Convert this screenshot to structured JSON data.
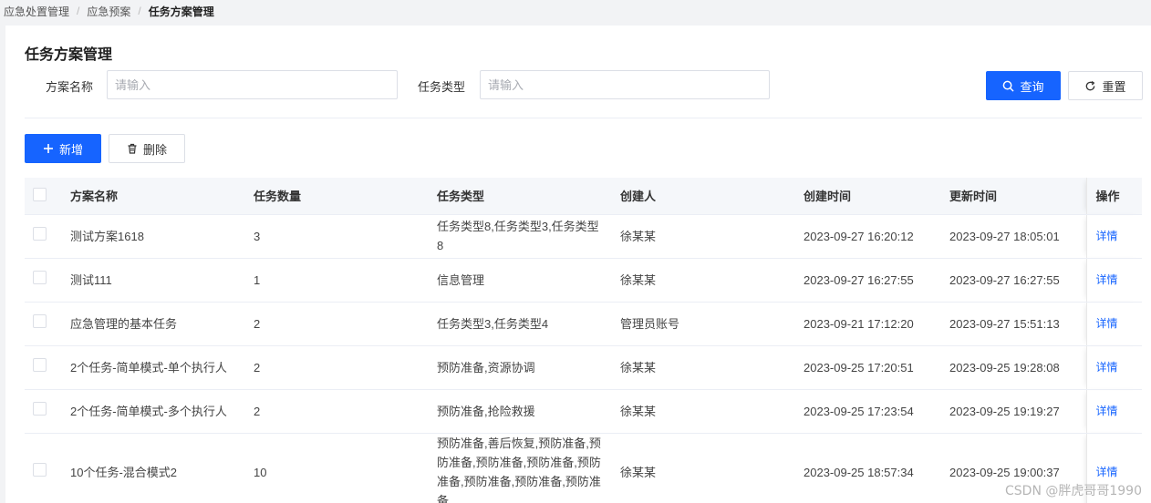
{
  "breadcrumb": [
    "应急处置管理",
    "应急预案",
    "任务方案管理"
  ],
  "page_title": "任务方案管理",
  "filters": {
    "name_label": "方案名称",
    "name_placeholder": "请输入",
    "type_label": "任务类型",
    "type_placeholder": "请输入"
  },
  "buttons": {
    "query": "查询",
    "reset": "重置",
    "add": "新增",
    "delete": "删除"
  },
  "table": {
    "columns": [
      "方案名称",
      "任务数量",
      "任务类型",
      "创建人",
      "创建时间",
      "更新时间",
      "操作"
    ],
    "rows": [
      {
        "name": "测试方案1618",
        "count": "3",
        "types": "任务类型8,任务类型3,任务类型8",
        "creator": "徐某某",
        "created": "2023-09-27 16:20:12",
        "updated": "2023-09-27 18:05:01",
        "action": "详情"
      },
      {
        "name": "测试111",
        "count": "1",
        "types": "信息管理",
        "creator": "徐某某",
        "created": "2023-09-27 16:27:55",
        "updated": "2023-09-27 16:27:55",
        "action": "详情"
      },
      {
        "name": "应急管理的基本任务",
        "count": "2",
        "types": "任务类型3,任务类型4",
        "creator": "管理员账号",
        "created": "2023-09-21 17:12:20",
        "updated": "2023-09-27 15:51:13",
        "action": "详情"
      },
      {
        "name": "2个任务-简单模式-单个执行人",
        "count": "2",
        "types": "预防准备,资源协调",
        "creator": "徐某某",
        "created": "2023-09-25 17:20:51",
        "updated": "2023-09-25 19:28:08",
        "action": "详情"
      },
      {
        "name": "2个任务-简单模式-多个执行人",
        "count": "2",
        "types": "预防准备,抢险救援",
        "creator": "徐某某",
        "created": "2023-09-25 17:23:54",
        "updated": "2023-09-25 19:19:27",
        "action": "详情"
      },
      {
        "name": "10个任务-混合模式2",
        "count": "10",
        "types": "预防准备,善后恢复,预防准备,预防准备,预防准备,预防准备,预防准备,预防准备,预防准备,预防准备",
        "creator": "徐某某",
        "created": "2023-09-25 18:57:34",
        "updated": "2023-09-25 19:00:37",
        "action": "详情"
      }
    ]
  },
  "watermark": "CSDN @胖虎哥哥1990"
}
